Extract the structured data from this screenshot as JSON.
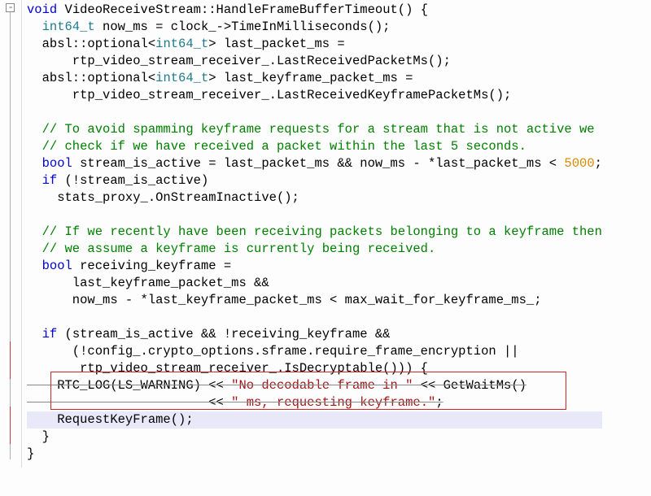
{
  "code": {
    "l1a": "void",
    "l1b": "VideoReceiveStream::HandleFrameBufferTimeout() {",
    "l2a": "  int64_t",
    "l2b": " now_ms = clock_->TimeInMilliseconds();",
    "l3a": "  absl::optional<",
    "l3b": "int64_t",
    "l3c": "> last_packet_ms =",
    "l4": "      rtp_video_stream_receiver_.LastReceivedPacketMs();",
    "l5a": "  absl::optional<",
    "l5b": "int64_t",
    "l5c": "> last_keyframe_packet_ms =",
    "l6": "      rtp_video_stream_receiver_.LastReceivedKeyframePacketMs();",
    "l7": "",
    "l8": "  // To avoid spamming keyframe requests for a stream that is not active we",
    "l9": "  // check if we have received a packet within the last 5 seconds.",
    "l10a": "  bool",
    "l10b": " stream_is_active = last_packet_ms && now_ms - *last_packet_ms < ",
    "l10c": "5000",
    "l10d": ";",
    "l11a": "  if",
    "l11b": " (!stream_is_active)",
    "l12": "    stats_proxy_.OnStreamInactive();",
    "l13": "",
    "l14": "  // If we recently have been receiving packets belonging to a keyframe then",
    "l15": "  // we assume a keyframe is currently being received.",
    "l16a": "  bool",
    "l16b": " receiving_keyframe =",
    "l17": "      last_keyframe_packet_ms &&",
    "l18": "      now_ms - *last_keyframe_packet_ms < max_wait_for_keyframe_ms_;",
    "l19": "",
    "l20a": "  if",
    "l20b": " (stream_is_active && !receiving_keyframe &&",
    "l21": "      (!config_.crypto_options.sframe.require_frame_encryption ||",
    "l22": "       rtp_video_stream_receiver_.IsDecryptable())) {",
    "l23a": "    RTC_LOG(LS_WARNING) << ",
    "l23b": "\"No decodable frame in \"",
    "l23c": " << GetWaitMs()",
    "l24a": "                        << ",
    "l24b": "\" ms, requesting keyframe.\"",
    "l24c": ";",
    "l25": "    RequestKeyFrame();",
    "l26": "  }",
    "l27": "}"
  }
}
